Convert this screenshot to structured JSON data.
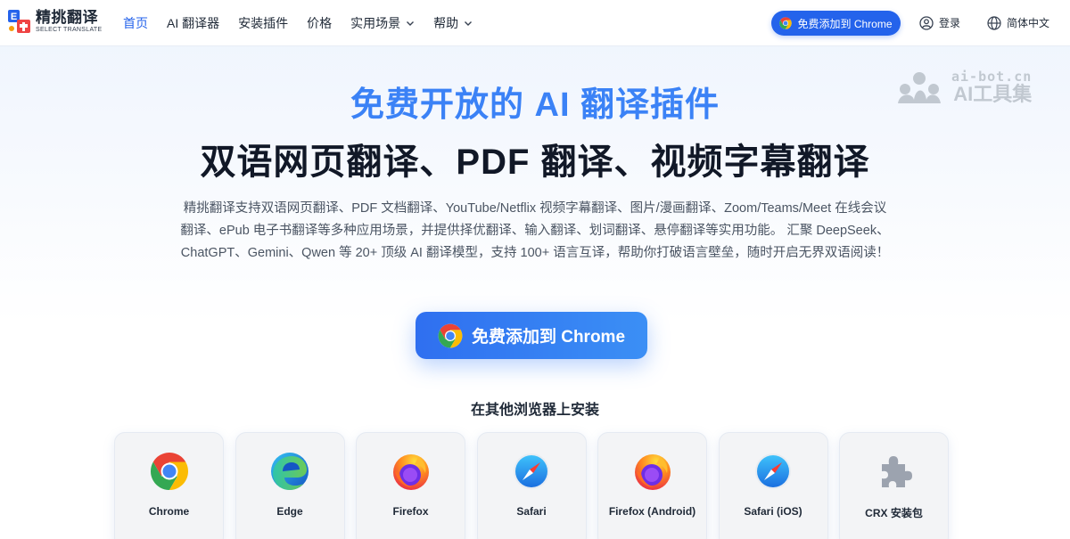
{
  "header": {
    "logo_title": "精挑翻译",
    "logo_sub": "SELECT TRANSLATE",
    "nav": [
      {
        "label": "首页"
      },
      {
        "label": "AI 翻译器"
      },
      {
        "label": "安装插件"
      },
      {
        "label": "价格"
      },
      {
        "label": "实用场景"
      },
      {
        "label": "帮助"
      }
    ],
    "cta_label": "免费添加到 Chrome",
    "login_label": "登录",
    "lang_label": "简体中文"
  },
  "watermark": {
    "url": "ai-bot.cn",
    "name": "AI工具集"
  },
  "hero": {
    "title1": "免费开放的 AI 翻译插件",
    "title2": "双语网页翻译、PDF 翻译、视频字幕翻译",
    "desc_line1": "精挑翻译支持双语网页翻译、PDF 文档翻译、YouTube/Netflix 视频字幕翻译、图片/漫画翻译、Zoom/Teams/Meet 在线会议",
    "desc_line2": "翻译、ePub 电子书翻译等多种应用场景，并提供择优翻译、输入翻译、划词翻译、悬停翻译等实用功能。 汇聚 DeepSeek、",
    "desc_line3": "ChatGPT、Gemini、Qwen 等 20+ 顶级 AI 翻译模型，支持 100+ 语言互译，帮助你打破语言壁垒，随时开启无界双语阅读！",
    "cta_label": "免费添加到 Chrome"
  },
  "other": {
    "title": "在其他浏览器上安装",
    "browsers": [
      {
        "label": "Chrome",
        "icon": "chrome-icon"
      },
      {
        "label": "Edge",
        "icon": "edge-icon"
      },
      {
        "label": "Firefox",
        "icon": "firefox-icon"
      },
      {
        "label": "Safari",
        "icon": "safari-icon"
      },
      {
        "label": "Firefox (Android)",
        "icon": "firefox-icon"
      },
      {
        "label": "Safari (iOS)",
        "icon": "safari-icon"
      },
      {
        "label": "CRX 安装包",
        "icon": "puzzle-icon"
      }
    ]
  },
  "colors": {
    "accent": "#2563eb",
    "title_blue": "#3b82f6"
  }
}
